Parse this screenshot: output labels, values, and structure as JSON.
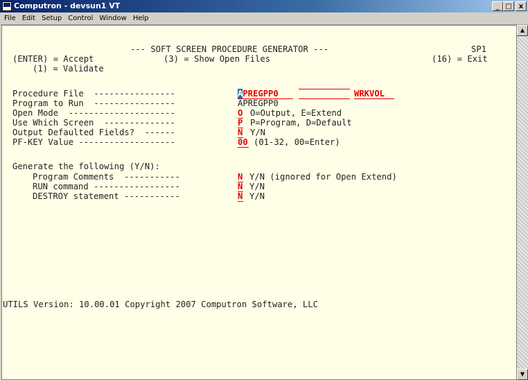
{
  "window": {
    "title": "Computron - devsun1 VT",
    "minimize": "_",
    "maximize": "□",
    "close": "x"
  },
  "menu": [
    "File",
    "Edit",
    "Setup",
    "Control",
    "Window",
    "Help"
  ],
  "screen": {
    "header": "--- SOFT SCREEN PROCEDURE GENERATOR ---",
    "screen_id": "SP1",
    "key_enter": "(ENTER) = Accept",
    "key_3": "(3) = Show Open Files",
    "key_16": "(16) = Exit",
    "key_1": "(1) = Validate",
    "procedure_file_label": "Procedure File  ----------------",
    "procedure_file_first_char": "A",
    "procedure_file_rest": "PREGPP0",
    "procedure_file_library": "",
    "procedure_file_volume": "WRKVOL",
    "program_to_run_label": "Program to Run  ----------------",
    "program_to_run": "APREGPP0",
    "program_library": "",
    "program_volume": "",
    "open_mode_label": "Open Mode  ---------------------",
    "open_mode": "O",
    "open_mode_hint": "O=Output, E=Extend",
    "which_screen_label": "Use Which Screen  --------------",
    "which_screen": "P",
    "which_screen_hint": "P=Program, D=Default",
    "output_defaulted_label": "Output Defaulted Fields?  ------",
    "output_defaulted": "N",
    "output_defaulted_hint": "Y/N",
    "pfkey_label": "PF-KEY Value -------------------",
    "pfkey": "00",
    "pfkey_hint": "(01-32, 00=Enter)",
    "generate_heading": "Generate the following (Y/N):",
    "program_comments_label": "Program Comments  -----------",
    "program_comments": "N",
    "program_comments_hint": "Y/N (ignored for Open Extend)",
    "run_command_label": "RUN command -----------------",
    "run_command": "N",
    "run_command_hint": "Y/N",
    "destroy_label": "DESTROY statement -----------",
    "destroy": "N",
    "destroy_hint": "Y/N",
    "footer": "UTILS Version: 10.00.01 Copyright 2007 Computron Software, LLC"
  }
}
